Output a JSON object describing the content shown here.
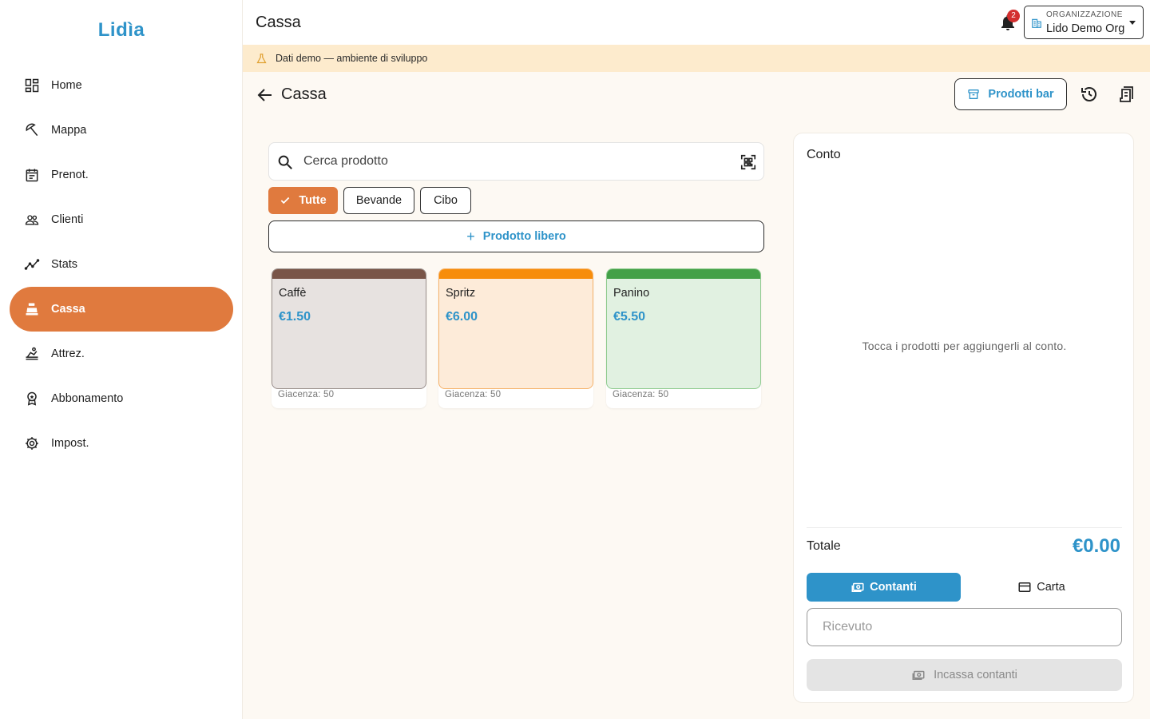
{
  "brand": {
    "name": "Lidia"
  },
  "sidebar": {
    "items": [
      {
        "label": "Home",
        "icon": "dashboard-icon"
      },
      {
        "label": "Mappa",
        "icon": "umbrella-icon"
      },
      {
        "label": "Prenot.",
        "icon": "calendar-icon"
      },
      {
        "label": "Clienti",
        "icon": "people-icon"
      },
      {
        "label": "Stats",
        "icon": "chart-icon"
      },
      {
        "label": "Cassa",
        "icon": "cash-register-icon",
        "active": true
      },
      {
        "label": "Attrez.",
        "icon": "beach-chair-icon"
      },
      {
        "label": "Abbonamento",
        "icon": "badge-icon"
      },
      {
        "label": "Impost.",
        "icon": "gear-icon"
      }
    ]
  },
  "topbar": {
    "title": "Cassa",
    "notifications_count": "2",
    "org_label": "ORGANIZZAZIONE",
    "org_value": "Lido Demo Org"
  },
  "banner": {
    "text": "Dati demo — ambiente di sviluppo"
  },
  "header": {
    "title": "Cassa",
    "products_button": "Prodotti bar"
  },
  "search": {
    "placeholder": "Cerca prodotto"
  },
  "filters": [
    {
      "label": "Tutte",
      "active": true
    },
    {
      "label": "Bevande",
      "active": false
    },
    {
      "label": "Cibo",
      "active": false
    }
  ],
  "free_product_label": "Prodotto libero",
  "products": [
    {
      "name": "Caffè",
      "price": "€1.50",
      "stock": "Giacenza: 50",
      "color": "#795548",
      "bg": "#e7e2e0",
      "border": "#9a8f8b"
    },
    {
      "name": "Spritz",
      "price": "€6.00",
      "stock": "Giacenza: 50",
      "color": "#f78d0b",
      "bg": "#fdebd9",
      "border": "#f6b36b"
    },
    {
      "name": "Panino",
      "price": "€5.50",
      "stock": "Giacenza: 50",
      "color": "#43a047",
      "bg": "#e1f1e1",
      "border": "#8fcb8f"
    }
  ],
  "conto": {
    "title": "Conto",
    "empty_text": "Tocca i prodotti per aggiungerli al conto.",
    "total_label": "Totale",
    "total_value": "€0.00",
    "cash_label": "Contanti",
    "card_label": "Carta",
    "received_placeholder": "Ricevuto",
    "collect_label": "Incassa contanti"
  },
  "colors": {
    "accent": "#e07a3e",
    "primary": "#2e93c9",
    "banner": "#fdebcd"
  }
}
